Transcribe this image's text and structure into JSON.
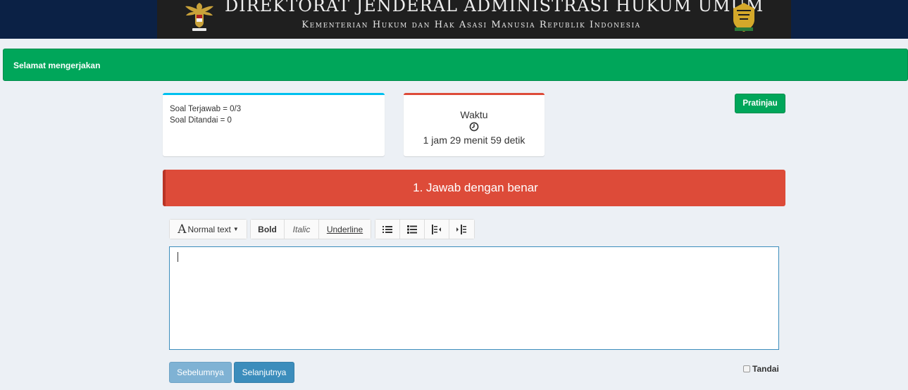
{
  "header": {
    "title": "DIREKTORAT JENDERAL ADMINISTRASI HUKUM UMUM",
    "subtitle": "Kementerian Hukum dan Hak Asasi Manusia Republik Indonesia"
  },
  "alert": {
    "message": "Selamat mengerjakan"
  },
  "status": {
    "answered": "Soal Terjawab = 0/3",
    "marked": "Soal Ditandai = 0"
  },
  "timer": {
    "label": "Waktu",
    "remaining": "1 jam 29 menit 59 detik"
  },
  "preview_button": "Pratinjau",
  "question": {
    "text": "1. Jawab dengan benar"
  },
  "toolbar": {
    "font_letter": "A",
    "font_style": "Normal text",
    "bold": "Bold",
    "italic": "Italic",
    "underline": "Underline",
    "icons": [
      "unordered-list-icon",
      "ordered-list-icon",
      "outdent-icon",
      "indent-icon"
    ]
  },
  "editor": {
    "value": ""
  },
  "nav": {
    "prev": "Sebelumnya",
    "next": "Selanjutnya"
  },
  "mark_checkbox": {
    "label": "Tandai",
    "checked": false
  },
  "colors": {
    "success": "#00a65a",
    "danger": "#dd4b39",
    "info": "#00c0ef",
    "primary": "#3c8dbc",
    "header_bg": "#0b2145"
  }
}
